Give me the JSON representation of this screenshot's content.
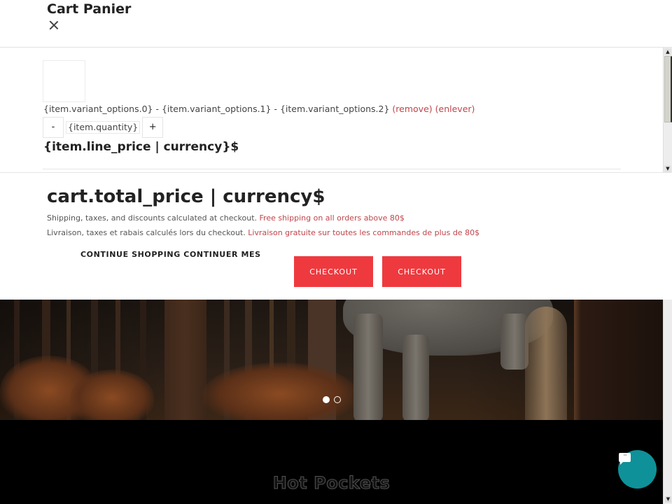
{
  "cart": {
    "title": "Cart Panier",
    "close_icon": "close-icon",
    "item": {
      "variant_options": [
        "{item.variant_options.0}",
        "{item.variant_options.1}",
        "{item.variant_options.2}"
      ],
      "separator": " - ",
      "remove_label": "(remove)",
      "remove_label_fr": "(enlever)",
      "quantity": "{item.quantity}",
      "decrement_label": "-",
      "increment_label": "+",
      "line_price": "{item.line_price | currency}$"
    },
    "total_price": "cart.total_price | currency$",
    "shipping_note_en": "Shipping, taxes, and discounts calculated at checkout.",
    "free_shipping_en": "Free shipping on all orders above 80$",
    "shipping_note_fr": "Livraison, taxes et rabais calculés lors du checkout.",
    "free_shipping_fr": "Livraison gratuite sur toutes les commandes de plus de 80$",
    "continue_shopping": "CONTINUE SHOPPING CONTINUER MES",
    "checkout_buttons": [
      "CHECKOUT",
      "CHECKOUT"
    ]
  },
  "page": {
    "slideshow": {
      "slide_count": 2,
      "active_slide": 1
    },
    "section_title": "Hot Pockets",
    "chat_widget_icon": "chat-icon"
  },
  "colors": {
    "accent": "#ee3a3f",
    "link_red": "#c0454b",
    "chat": "#0f9199"
  }
}
